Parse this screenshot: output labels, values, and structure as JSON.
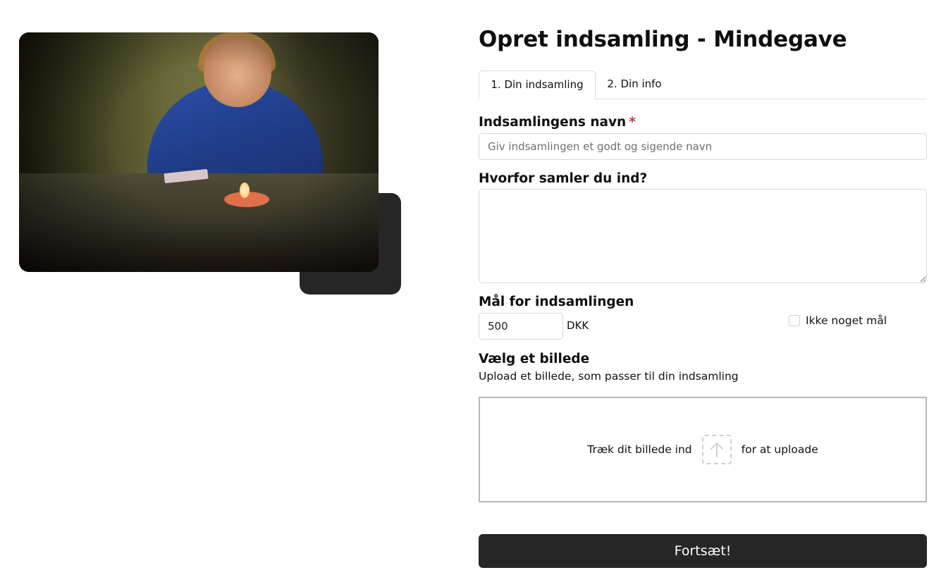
{
  "page": {
    "title": "Opret indsamling - Mindegave"
  },
  "hero_image": {
    "description": "photo-of-woman-at-table-with-candle"
  },
  "tabs": [
    {
      "label": "1. Din indsamling",
      "active": true
    },
    {
      "label": "2. Din info",
      "active": false
    }
  ],
  "fields": {
    "name": {
      "label": "Indsamlingens navn",
      "required_mark": "*",
      "placeholder": "Giv indsamlingen et godt og sigende navn",
      "value": ""
    },
    "reason": {
      "label": "Hvorfor samler du ind?",
      "value": ""
    },
    "goal": {
      "label": "Mål for indsamlingen",
      "value": "500",
      "currency": "DKK",
      "no_goal_label": "Ikke noget mål",
      "no_goal_checked": false
    },
    "image": {
      "label": "Vælg et billede",
      "hint": "Upload et billede, som passer til din indsamling",
      "drop_text_before": "Træk dit billede ind",
      "drop_text_after": "for at uploade",
      "icon": "upload-arrow-icon"
    }
  },
  "actions": {
    "submit_label": "Fortsæt!"
  },
  "colors": {
    "button_bg": "#262626",
    "required": "#c0394b",
    "border": "#d7d7d7"
  }
}
